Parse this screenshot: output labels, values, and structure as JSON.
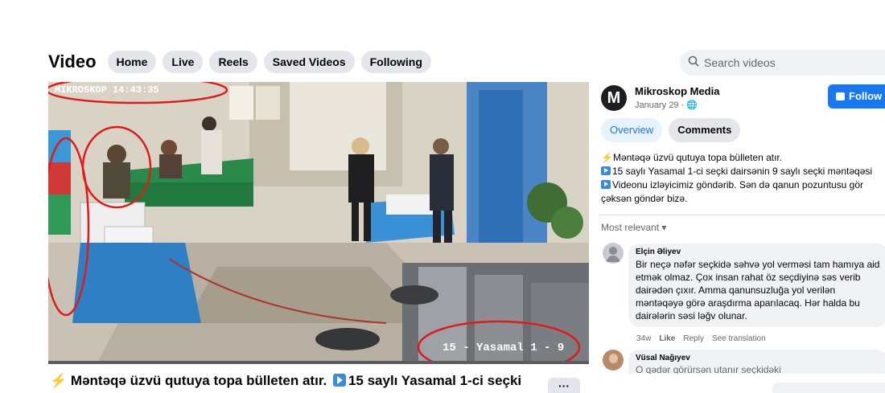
{
  "header": {
    "title": "Video",
    "tabs": [
      "Home",
      "Live",
      "Reels",
      "Saved Videos",
      "Following"
    ]
  },
  "search": {
    "placeholder": "Search videos",
    "icon": "search-icon"
  },
  "video": {
    "overlay_top": "MIKROSKOP 14:43:35",
    "overlay_bottom": "15 - Yasamal 1 - 9",
    "title_part1": "Məntəqə üzvü qutuya topa bülleten atır.",
    "title_part2": "15 saylı Yasamal 1-ci seçki",
    "more_label": "···",
    "annotation_color": "#e01b1b"
  },
  "post": {
    "page_name": "Mikroskop Media",
    "avatar_letter": "M",
    "date": "January 29 · 🌐",
    "follow_label": "Follow",
    "tabs": [
      "Overview",
      "Comments"
    ],
    "description": [
      "Məntəqə üzvü qutuya topa bülleten atır.",
      "15 saylı Yasamal 1-ci seçki dairsənin 9 saylı seçki məntəqəsi",
      "Videonu izləyicimiz göndərib. Sən də qanun pozuntusu gör",
      "çəksən göndər bizə."
    ]
  },
  "comments": {
    "sort_label": "Most relevant ▾",
    "items": [
      {
        "author": "Elçin Əliyev",
        "text": "Bir neçə nəfər seçkidə səhvə yol verməsi tam hamıya aid etmək olmaz. Çox insan rahat öz seçdiyinə səs verib dairədən çıxır. Amma qanunsuzluğa yol verilən məntəqəyə görə araşdırma aparılacaq. Hər halda bu dairələrin səsi ləğv olunar.",
        "time": "34w",
        "like": "Like",
        "reply": "Reply",
        "translate": "See translation"
      },
      {
        "author": "Vüsal Nağıyev",
        "text": "O qədər görürsən utanır seçkidəki"
      }
    ]
  },
  "colors": {
    "accent": "#1877f2",
    "tab_bg": "#e4e6eb"
  }
}
